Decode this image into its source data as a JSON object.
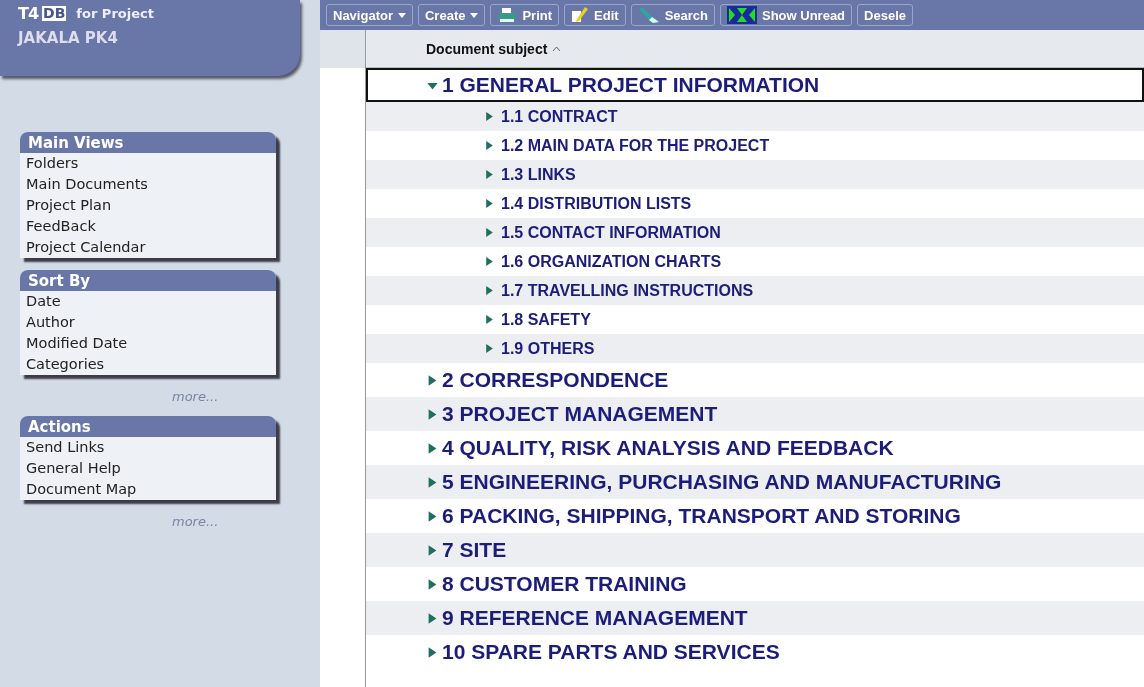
{
  "app": {
    "logo_parts": [
      "T4",
      "DB"
    ],
    "tagline": "for Project",
    "project": "JAKALA PK4"
  },
  "sidebar": [
    {
      "title": "Main Views",
      "items": [
        "Folders",
        "Main Documents",
        "Project Plan",
        "FeedBack",
        "Project Calendar"
      ]
    },
    {
      "title": "Sort By",
      "items": [
        "Date",
        "Author",
        "Modified Date",
        "Categories"
      ],
      "more": "more..."
    },
    {
      "title": "Actions",
      "items": [
        "Send Links",
        "General Help",
        "Document Map"
      ],
      "more": "more..."
    }
  ],
  "toolbar": [
    {
      "label": "Navigator",
      "kind": "dropdown"
    },
    {
      "label": "Create",
      "kind": "dropdown"
    },
    {
      "label": "Print",
      "kind": "print"
    },
    {
      "label": "Edit",
      "kind": "edit"
    },
    {
      "label": "Search",
      "kind": "search"
    },
    {
      "label": "Show Unread",
      "kind": "unread"
    },
    {
      "label": "Desele",
      "kind": "plain"
    }
  ],
  "column": {
    "label": "Document subject",
    "sorted_ascending": true
  },
  "tree": [
    {
      "label": "1 GENERAL PROJECT INFORMATION",
      "expanded": true,
      "selected": true,
      "children": [
        {
          "label": "1.1 CONTRACT",
          "expanded": false,
          "selected": false
        },
        {
          "label": "1.2 MAIN DATA FOR THE PROJECT",
          "expanded": false,
          "selected": false
        },
        {
          "label": "1.3 LINKS",
          "expanded": false,
          "selected": false
        },
        {
          "label": "1.4 DISTRIBUTION LISTS",
          "expanded": false,
          "selected": false
        },
        {
          "label": "1.5 CONTACT INFORMATION",
          "expanded": false,
          "selected": false
        },
        {
          "label": "1.6 ORGANIZATION CHARTS",
          "expanded": false,
          "selected": false
        },
        {
          "label": "1.7 TRAVELLING INSTRUCTIONS",
          "expanded": false,
          "selected": false
        },
        {
          "label": "1.8 SAFETY",
          "expanded": false,
          "selected": false
        },
        {
          "label": "1.9 OTHERS",
          "expanded": false,
          "selected": false
        }
      ]
    },
    {
      "label": "2 CORRESPONDENCE",
      "expanded": false,
      "selected": false
    },
    {
      "label": "3 PROJECT MANAGEMENT",
      "expanded": false,
      "selected": false
    },
    {
      "label": "4 QUALITY, RISK ANALYSIS AND FEEDBACK",
      "expanded": false,
      "selected": false
    },
    {
      "label": "5 ENGINEERING, PURCHASING AND MANUFACTURING",
      "expanded": false,
      "selected": false
    },
    {
      "label": "6 PACKING, SHIPPING, TRANSPORT AND STORING",
      "expanded": false,
      "selected": false
    },
    {
      "label": "7 SITE",
      "expanded": false,
      "selected": false
    },
    {
      "label": "8 CUSTOMER TRAINING",
      "expanded": false,
      "selected": false
    },
    {
      "label": "9 REFERENCE MANAGEMENT",
      "expanded": false,
      "selected": false
    },
    {
      "label": "10 SPARE PARTS AND SERVICES",
      "expanded": false,
      "selected": false
    }
  ]
}
